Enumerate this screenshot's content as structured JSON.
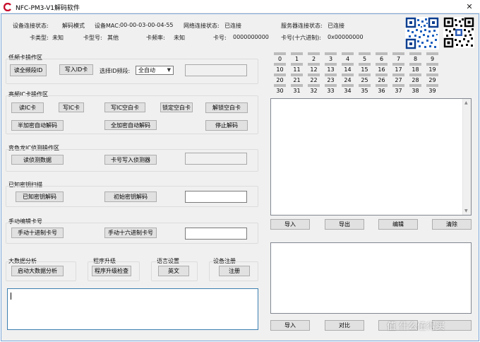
{
  "window": {
    "title": "NFC-PM3-V1解码软件",
    "close_glyph": "✕"
  },
  "status": {
    "conn_state_label": "设备连接状态:",
    "conn_state_value": "解码模式",
    "mac_label": "设备MAC:",
    "mac_value": "00-00-03-00-04-55",
    "net_label": "网络连接状态:",
    "net_value": "已连接",
    "server_label": "服务器连接状态:",
    "server_value": "已连接",
    "card_type_label": "卡类型:",
    "card_type_value": "未知",
    "card_model_label": "卡型号:",
    "card_model_value": "其他",
    "freq_label": "卡频率:",
    "freq_value": "未知",
    "card_no_label": "卡号:",
    "card_no_value": "0000000000",
    "card_hex_label": "卡号(十六进制):",
    "card_hex_value": "0x00000000"
  },
  "low_freq": {
    "title": "低频卡操作区",
    "read_id": "读全频段ID",
    "write_id": "写入ID卡",
    "band_label": "选择ID频段:",
    "band_value": "全自动",
    "input_value": ""
  },
  "hf": {
    "title": "高频IC卡操作区",
    "read_ic": "读IC卡",
    "write_ic": "写IC卡",
    "write_blank": "写IC空白卡",
    "lock_blank": "锁定空白卡",
    "unlock_blank": "解锁空白卡",
    "half_auto": "半加密自动解码",
    "full_auto": "全加密自动解码",
    "stop": "停止解码"
  },
  "sniffer": {
    "title": "变色龙IC侦测操作区",
    "read_data": "读侦测数据",
    "write_detector": "卡号写入侦测器",
    "input_value": ""
  },
  "known_key": {
    "title": "已知密钥扫描",
    "decode": "已知密钥解码",
    "init": "初始密钥解码",
    "input_value": ""
  },
  "manual": {
    "title": "手动编辑卡号",
    "decimal": "手动十进制卡号",
    "hex": "手动十六进制卡号",
    "input_value": ""
  },
  "bigdata": {
    "title": "大数据分析",
    "button": "启动大数据分析"
  },
  "upgrade": {
    "title": "程序升级",
    "button": "程序升级检查"
  },
  "language": {
    "title": "语言设置",
    "button": "英文"
  },
  "register": {
    "title": "设备注册",
    "button": "注册"
  },
  "sectors": {
    "row1": [
      "0",
      "1",
      "2",
      "3",
      "4",
      "5",
      "6",
      "7",
      "8",
      "9"
    ],
    "row2": [
      "10",
      "11",
      "12",
      "13",
      "14",
      "15",
      "16",
      "17",
      "18",
      "19"
    ],
    "row3": [
      "20",
      "21",
      "22",
      "23",
      "24",
      "25",
      "26",
      "27",
      "28",
      "29"
    ],
    "row4": [
      "30",
      "31",
      "32",
      "33",
      "34",
      "35",
      "36",
      "37",
      "38",
      "39"
    ]
  },
  "upper_buttons": {
    "import": "导入",
    "export": "导出",
    "edit": "编辑",
    "clear": "清除"
  },
  "lower_buttons": {
    "import": "导入",
    "compare": "对比",
    "third": "",
    "fourth": ""
  },
  "watermark": "值 什么值得买"
}
